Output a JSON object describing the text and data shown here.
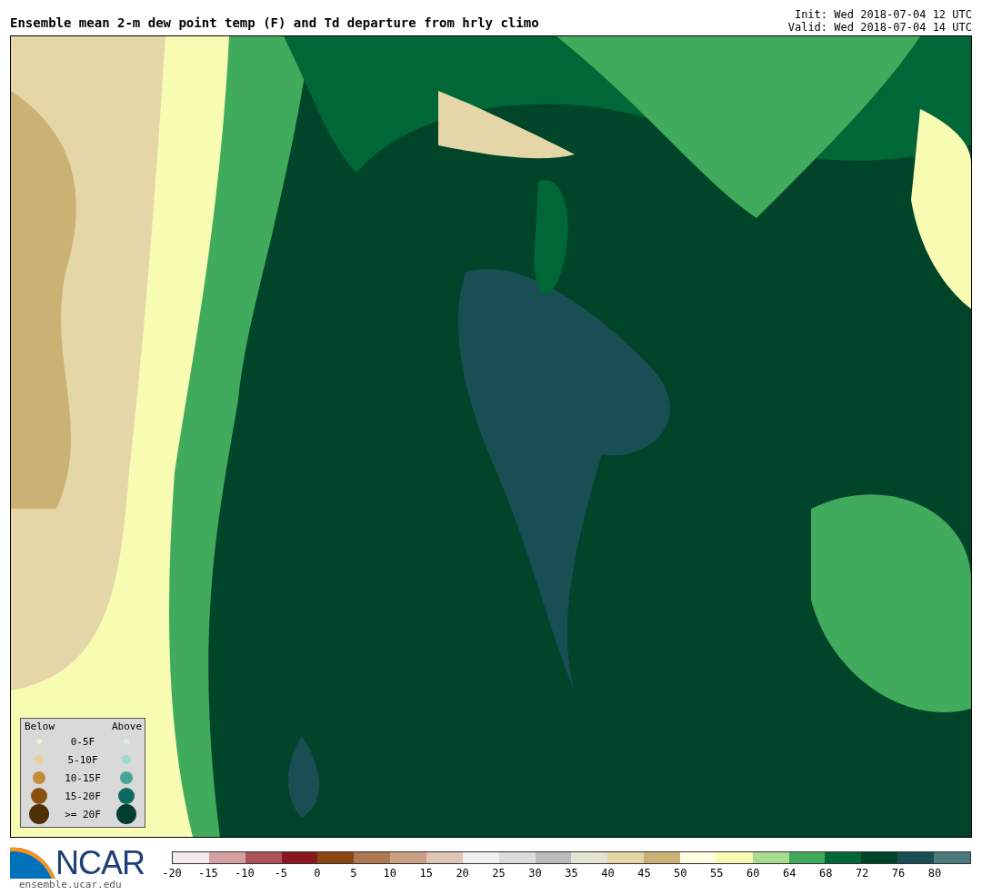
{
  "title": "Ensemble mean 2-m dew point temp (F) and Td departure from hrly climo",
  "init": "Init: Wed 2018-07-04 12 UTC",
  "valid": "Valid: Wed 2018-07-04 14 UTC",
  "legend": {
    "below_header": "Below",
    "above_header": "Above",
    "rows": [
      {
        "label": "0-5F",
        "dots": [
          {
            "color": "#f3ead8"
          },
          {
            "color": "#d9eeee"
          }
        ]
      },
      {
        "label": "5-10F",
        "dots": [
          {
            "color": "#e8cf95"
          },
          {
            "color": "#9adbd2"
          }
        ]
      },
      {
        "label": "10-15F",
        "dots": [
          {
            "color": "#c38b3c"
          },
          {
            "color": "#46a598"
          }
        ]
      },
      {
        "label": "15-20F",
        "dots": [
          {
            "color": "#8b5010"
          },
          {
            "color": "#0b6b62"
          }
        ]
      },
      {
        "label": ">= 20F",
        "dots": [
          {
            "color": "#513008"
          },
          {
            "color": "#033c30"
          }
        ]
      }
    ]
  },
  "logo": {
    "text": "NCAR",
    "url": "ensemble.ucar.edu"
  },
  "colorbar": [
    {
      "label": "-20",
      "color": "#f5eaea"
    },
    {
      "label": "-15",
      "color": "#d4a0a2"
    },
    {
      "label": "-10",
      "color": "#ae5458"
    },
    {
      "label": "-5",
      "color": "#8b1820"
    },
    {
      "label": "0",
      "color": "#8a4512"
    },
    {
      "label": "5",
      "color": "#b07852"
    },
    {
      "label": "10",
      "color": "#c9a084"
    },
    {
      "label": "15",
      "color": "#e0c6b5"
    },
    {
      "label": "20",
      "color": "#f0f0f0"
    },
    {
      "label": "25",
      "color": "#dcdcdc"
    },
    {
      "label": "30",
      "color": "#bbbbbb"
    },
    {
      "label": "35",
      "color": "#e3e4d3"
    },
    {
      "label": "40",
      "color": "#e5d6a8"
    },
    {
      "label": "45",
      "color": "#cbb274"
    },
    {
      "label": "50",
      "color": "#fefee0"
    },
    {
      "label": "55",
      "color": "#f8fcb3"
    },
    {
      "label": "60",
      "color": "#a9dc8c"
    },
    {
      "label": "64",
      "color": "#41ab5d"
    },
    {
      "label": "68",
      "color": "#006837"
    },
    {
      "label": "72",
      "color": "#00442a"
    },
    {
      "label": "76",
      "color": "#1a4e55"
    },
    {
      "label": "80",
      "color": "#4c7a7c"
    }
  ]
}
